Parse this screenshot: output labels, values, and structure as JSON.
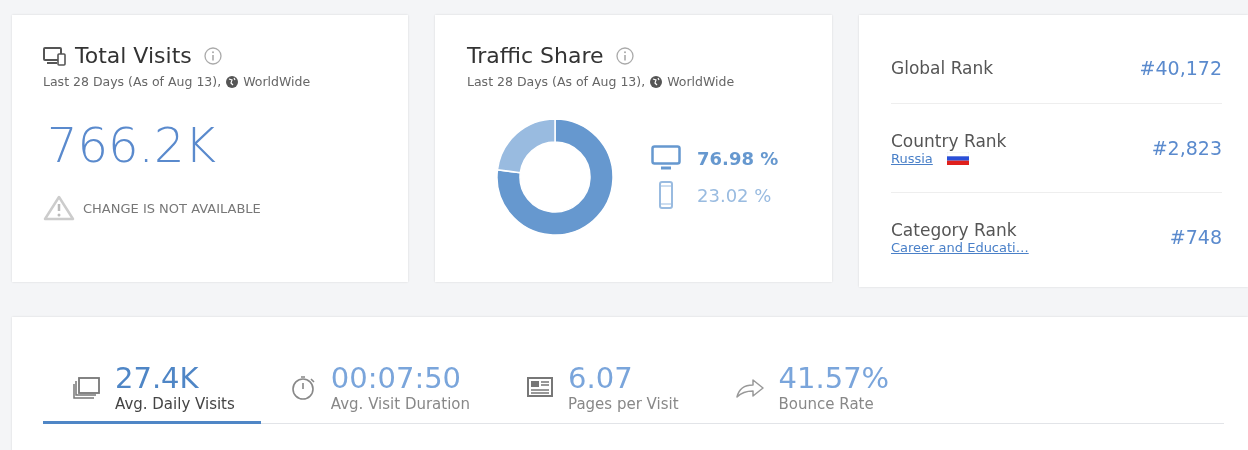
{
  "total_visits": {
    "title": "Total Visits",
    "period": "Last 28 Days (As of Aug 13),",
    "region": "WorldWide",
    "value": "766.2K",
    "change_note": "CHANGE IS NOT AVAILABLE"
  },
  "traffic_share": {
    "title": "Traffic Share",
    "period": "Last 28 Days (As of Aug 13),",
    "region": "WorldWide",
    "legend": [
      {
        "kind": "desktop",
        "label": "76.98 %",
        "color": "#6698cf"
      },
      {
        "kind": "mobile",
        "label": "23.02 %",
        "color": "#99bbe0"
      }
    ],
    "chart_data": {
      "type": "donut",
      "values": [
        76.98,
        23.02
      ]
    }
  },
  "ranks": [
    {
      "label": "Global Rank",
      "value": "#40,172"
    },
    {
      "label": "Country Rank",
      "link": "Russia",
      "flag": true,
      "value": "#2,823"
    },
    {
      "label": "Category Rank",
      "link": "Career and Educati…",
      "value": "#748"
    }
  ],
  "metrics": [
    {
      "kind": "visits",
      "value": "27.4K",
      "label": "Avg. Daily Visits",
      "selected": true
    },
    {
      "kind": "duration",
      "value": "00:07:50",
      "label": "Avg. Visit Duration",
      "selected": false
    },
    {
      "kind": "pages",
      "value": "6.07",
      "label": "Pages per Visit",
      "selected": false
    },
    {
      "kind": "bounce",
      "value": "41.57%",
      "label": "Bounce Rate",
      "selected": false
    }
  ]
}
